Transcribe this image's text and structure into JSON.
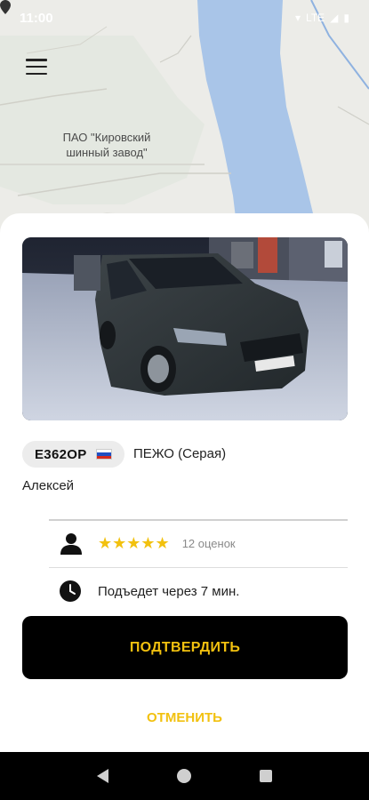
{
  "status_bar": {
    "time": "11:00",
    "network": "LTE"
  },
  "map": {
    "poi_label": "ПАО \"Кировский шинный завод\"",
    "water_color": "#a9c5e8",
    "land_color": "#ecece8"
  },
  "car": {
    "plate": "Е362ОР",
    "flag_colors": [
      "#ffffff",
      "#1f4fc2",
      "#d52b1e"
    ],
    "model": "ПЕЖО (Серая)",
    "driver_name": "Алексей"
  },
  "rating": {
    "stars": "★★★★★",
    "star_count": 5,
    "count_label": "12 оценок"
  },
  "eta": {
    "text": "Подъедет через 7 мин."
  },
  "actions": {
    "confirm_label": "ПОДТВЕРДИТЬ",
    "cancel_label": "ОТМЕНИТЬ"
  },
  "colors": {
    "accent": "#f2c10f",
    "button_bg": "#000000"
  },
  "icons": {
    "menu": "menu-icon",
    "person": "person-icon",
    "clock": "clock-icon",
    "pin": "map-pin-icon"
  }
}
